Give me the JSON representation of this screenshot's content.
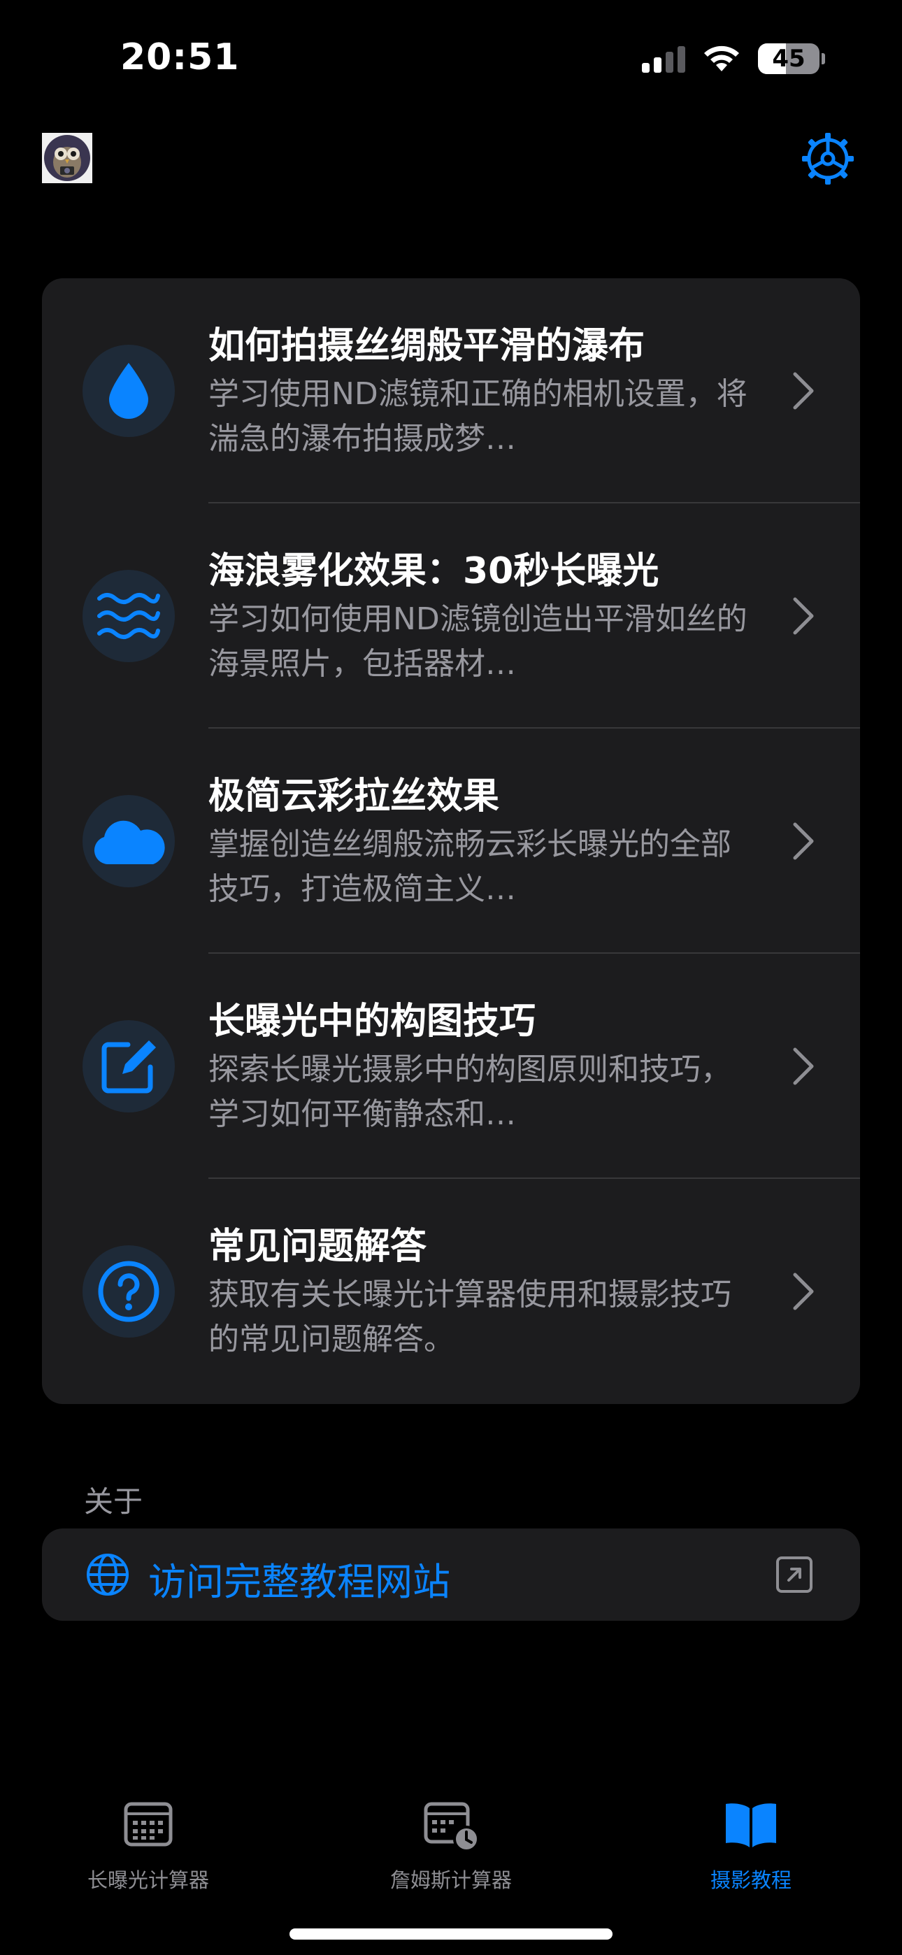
{
  "status_bar": {
    "time": "20:51",
    "battery_level": "45",
    "signal_bars_active": 2,
    "signal_bars_total": 4
  },
  "header": {
    "avatar_icon": "owl-photographer-avatar",
    "settings_icon": "gear-icon"
  },
  "tutorials": [
    {
      "icon": "water-drop-icon",
      "title": "如何拍摄丝绸般平滑的瀑布",
      "description": "学习使用ND滤镜和正确的相机设置，将湍急的瀑布拍摄成梦…"
    },
    {
      "icon": "waves-icon",
      "title": "海浪雾化效果：30秒长曝光",
      "description": "学习如何使用ND滤镜创造出平滑如丝的海景照片，包括器材…"
    },
    {
      "icon": "cloud-icon",
      "title": "极简云彩拉丝效果",
      "description": "掌握创造丝绸般流畅云彩长曝光的全部技巧，打造极简主义…"
    },
    {
      "icon": "square-pen-icon",
      "title": "长曝光中的构图技巧",
      "description": "探索长曝光摄影中的构图原则和技巧，学习如何平衡静态和…"
    },
    {
      "icon": "question-circle-icon",
      "title": "常见问题解答",
      "description": "获取有关长曝光计算器使用和摄影技巧的常见问题解答。"
    }
  ],
  "about": {
    "section_label": "关于",
    "website_link": "访问完整教程网站"
  },
  "tabs": [
    {
      "label": "长曝光计算器",
      "icon": "calculator-icon",
      "active": false
    },
    {
      "label": "詹姆斯计算器",
      "icon": "calculator-clock-icon",
      "active": false
    },
    {
      "label": "摄影教程",
      "icon": "book-icon",
      "active": true
    }
  ],
  "colors": {
    "accent": "#0a84ff",
    "background": "#000000",
    "card": "#1c1c1e",
    "secondary_text": "#98989f",
    "icon_circle": "#1e2a38"
  }
}
